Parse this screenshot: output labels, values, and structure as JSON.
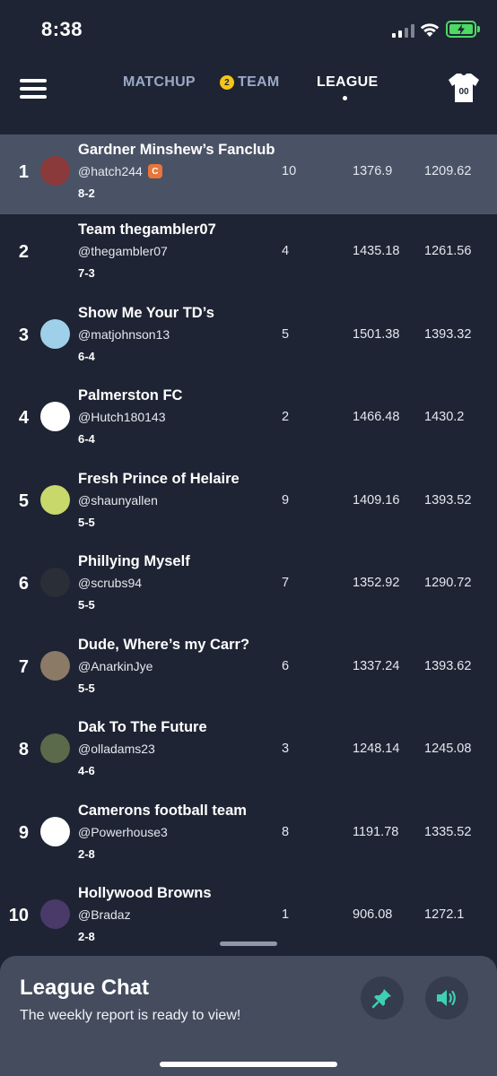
{
  "status_bar": {
    "time": "8:38"
  },
  "nav": {
    "tabs": [
      {
        "label": "MATCHUP",
        "active": false
      },
      {
        "label": "TEAM",
        "badge": "2",
        "active": false
      },
      {
        "label": "LEAGUE",
        "active": true
      }
    ],
    "jersey_number": "00"
  },
  "standings": [
    {
      "rank": "1",
      "name": "Gardner Minshew’s Fanclub",
      "handle": "@hatch244",
      "handle_badge": "C",
      "record": "8-2",
      "power_rank": "10",
      "points_for": "1376.9",
      "points_against": "1209.62",
      "highlight": true,
      "avatar_color": "#8a3a3a"
    },
    {
      "rank": "2",
      "name": "Team thegambler07",
      "handle": "@thegambler07",
      "record": "7-3",
      "power_rank": "4",
      "points_for": "1435.18",
      "points_against": "1261.56",
      "avatar_color": "#1e2433"
    },
    {
      "rank": "3",
      "name": "Show Me Your TD’s",
      "handle": "@matjohnson13",
      "record": "6-4",
      "power_rank": "5",
      "points_for": "1501.38",
      "points_against": "1393.32",
      "avatar_color": "#9fd0ea"
    },
    {
      "rank": "4",
      "name": "Palmerston FC",
      "handle": "@Hutch180143",
      "record": "6-4",
      "power_rank": "2",
      "points_for": "1466.48",
      "points_against": "1430.2",
      "avatar_color": "#ffffff"
    },
    {
      "rank": "5",
      "name": "Fresh Prince of Helaire",
      "handle": "@shaunyallen",
      "record": "5-5",
      "power_rank": "9",
      "points_for": "1409.16",
      "points_against": "1393.52",
      "avatar_color": "#c8d86a"
    },
    {
      "rank": "6",
      "name": "Phillying Myself",
      "handle": "@scrubs94",
      "record": "5-5",
      "power_rank": "7",
      "points_for": "1352.92",
      "points_against": "1290.72",
      "avatar_color": "#2a2e36"
    },
    {
      "rank": "7",
      "name": "Dude, Where’s my Carr?",
      "handle": "@AnarkinJye",
      "record": "5-5",
      "power_rank": "6",
      "points_for": "1337.24",
      "points_against": "1393.62",
      "avatar_color": "#8a7a66"
    },
    {
      "rank": "8",
      "name": "Dak To The Future",
      "handle": "@olladams23",
      "record": "4-6",
      "power_rank": "3",
      "points_for": "1248.14",
      "points_against": "1245.08",
      "avatar_color": "#5a6a4a"
    },
    {
      "rank": "9",
      "name": "Camerons football team",
      "handle": "@Powerhouse3",
      "record": "2-8",
      "power_rank": "8",
      "points_for": "1191.78",
      "points_against": "1335.52",
      "avatar_color": "#ffffff"
    },
    {
      "rank": "10",
      "name": "Hollywood Browns",
      "handle": "@Bradaz",
      "record": "2-8",
      "power_rank": "1",
      "points_for": "906.08",
      "points_against": "1272.1",
      "avatar_color": "#4a3a6a"
    }
  ],
  "chat": {
    "title": "League Chat",
    "message": "The weekly report is ready to view!"
  },
  "colors": {
    "background": "#1e2433",
    "highlight_row": "#4a5366",
    "chat_panel": "#444c5e",
    "accent_teal": "#3fcfb2",
    "nav_inactive": "#9ba9c8",
    "badge_yellow": "#f5c518",
    "badge_orange": "#e8763a"
  }
}
